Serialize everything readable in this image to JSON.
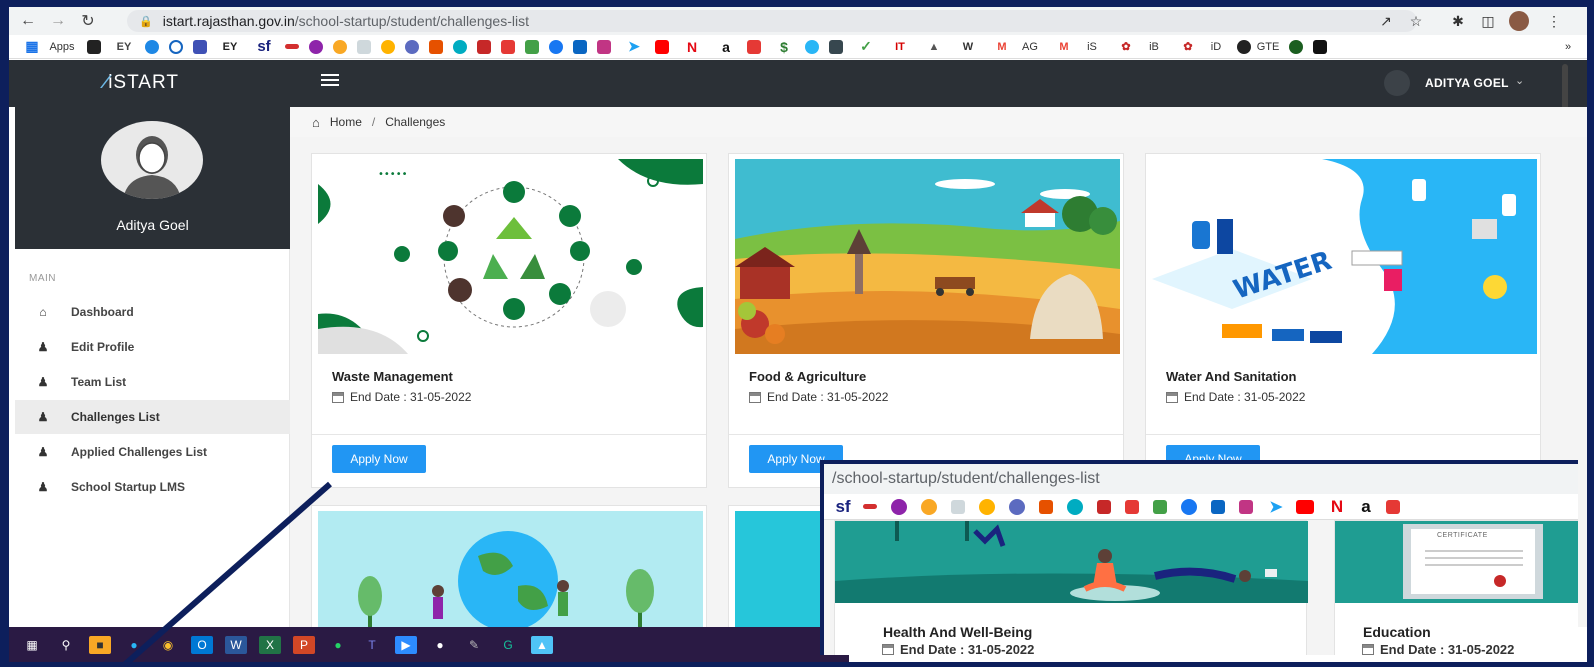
{
  "browser": {
    "url_host": "istart.rajasthan.gov.in",
    "url_path": "/school-startup/student/challenges-list",
    "bookmarks": [
      "Apps",
      "EY",
      "EY",
      "sf",
      "a",
      "IT",
      "W",
      "AG",
      "iS",
      "iB",
      "iD",
      "GTE",
      "»"
    ]
  },
  "app": {
    "logo": "iSTART",
    "user_menu": "ADITYA GOEL"
  },
  "profile": {
    "name": "Aditya Goel"
  },
  "sidebar": {
    "heading": "MAIN",
    "items": [
      {
        "label": "Dashboard",
        "icon": "home-icon"
      },
      {
        "label": "Edit Profile",
        "icon": "user-icon"
      },
      {
        "label": "Team List",
        "icon": "user-icon"
      },
      {
        "label": "Challenges List",
        "icon": "user-icon",
        "active": true
      },
      {
        "label": "Applied Challenges List",
        "icon": "user-icon"
      },
      {
        "label": "School Startup LMS",
        "icon": "user-icon"
      }
    ]
  },
  "breadcrumb": {
    "home": "Home",
    "separator": "/",
    "current": "Challenges"
  },
  "cards": [
    {
      "title": "Waste Management",
      "date": "End Date : 31-05-2022",
      "button": "Apply Now"
    },
    {
      "title": "Food & Agriculture",
      "date": "End Date : 31-05-2022",
      "button": "Apply Now"
    },
    {
      "title": "Water And Sanitation",
      "date": "End Date : 31-05-2022",
      "button": "Apply Now"
    }
  ],
  "inset": {
    "url_path": "/school-startup/student/challenges-list",
    "bookmarks": [
      "sf",
      "a"
    ],
    "cards": [
      {
        "title": "Health And Well-Being",
        "date": "End Date : 31-05-2022"
      },
      {
        "title": "Education",
        "date": "End Date : 31-05-2022"
      }
    ],
    "certificate_text": "CERTIFICATE"
  },
  "colors": {
    "primary_button": "#2196f3",
    "header_dark": "#2b3036",
    "frame_navy": "#0d1f5c",
    "taskbar": "#2a1a44"
  }
}
